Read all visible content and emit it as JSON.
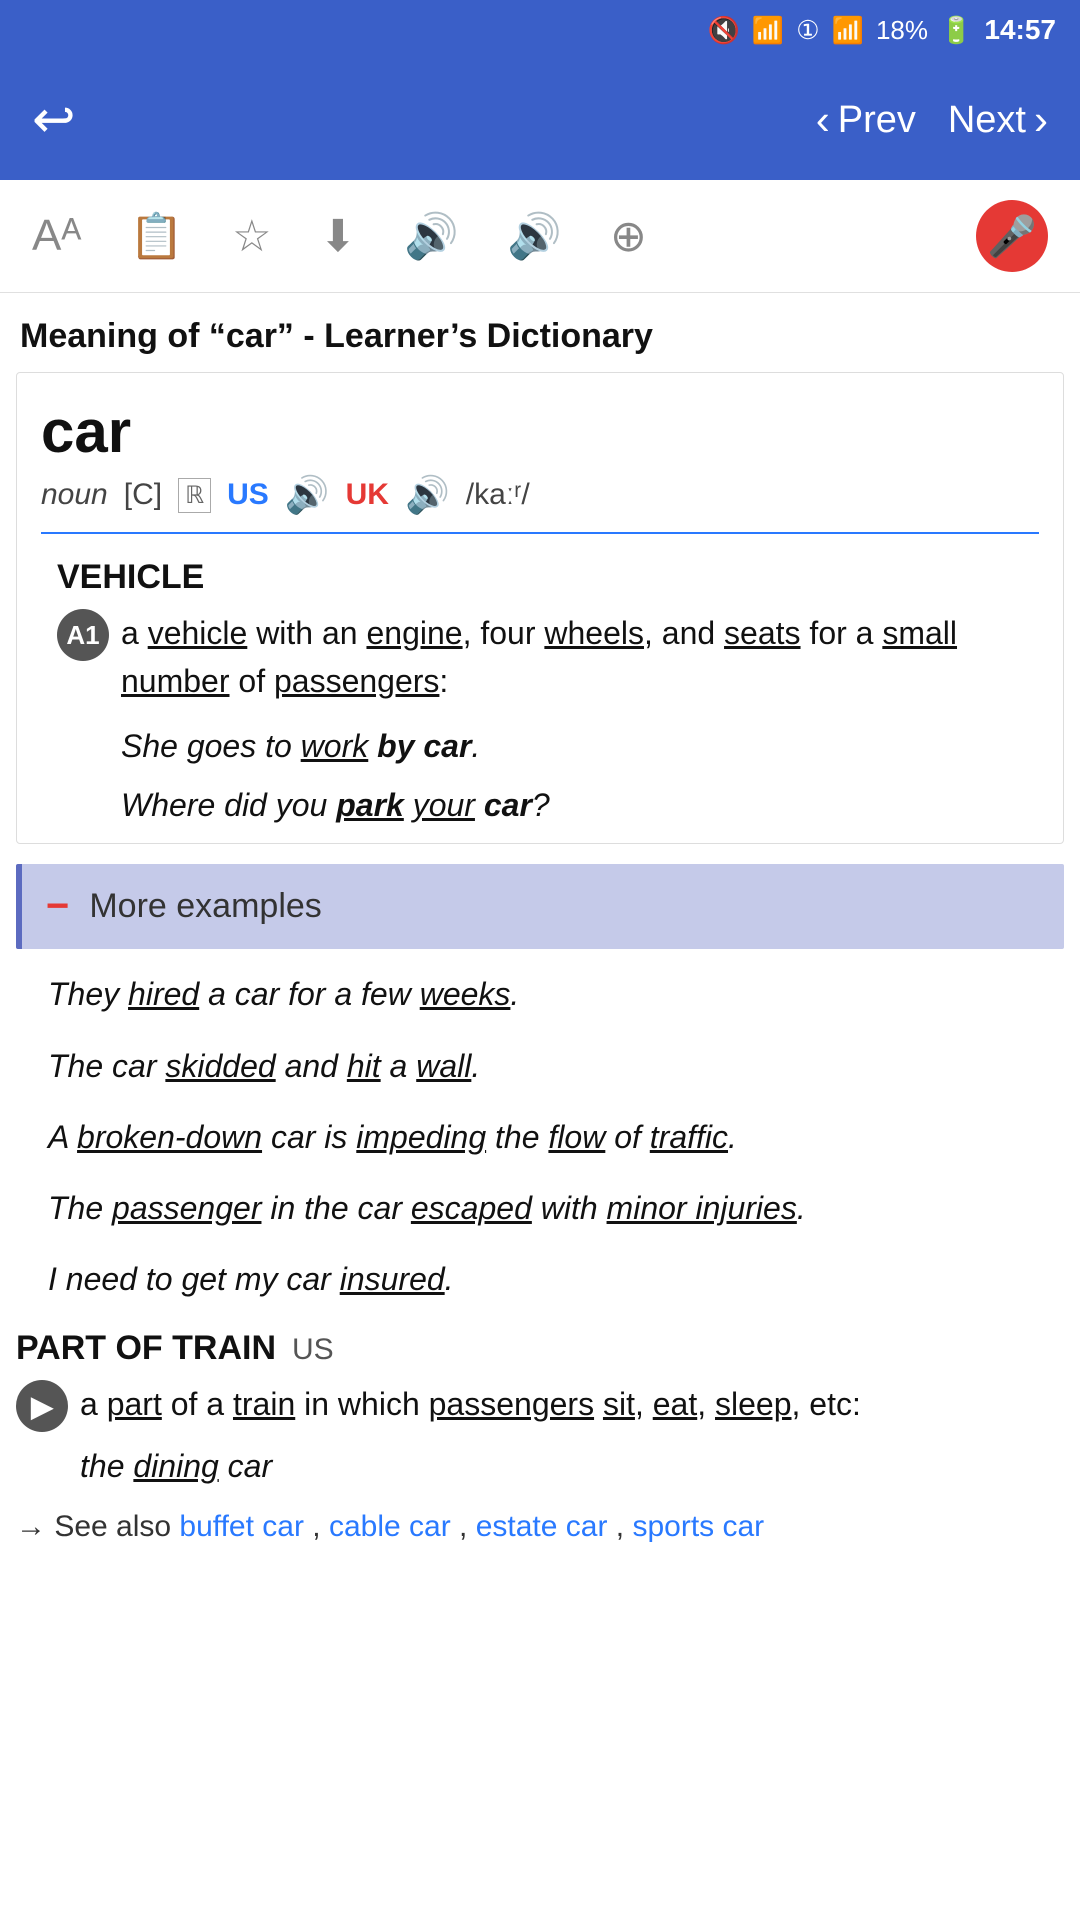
{
  "status_bar": {
    "time": "14:57",
    "battery": "18%",
    "signal": "4G"
  },
  "nav": {
    "prev_label": "Prev",
    "next_label": "Next"
  },
  "toolbar": {
    "icons": [
      "Aa",
      "copy",
      "star",
      "download",
      "sound-blue",
      "sound-red",
      "plus"
    ]
  },
  "page_title": "Meaning of “car” - Learner’s Dictionary",
  "entry": {
    "word": "car",
    "pos": "noun",
    "countable": "[C]",
    "us_label": "US",
    "uk_label": "UK",
    "phonetic": "/kaːʳ/",
    "sections": [
      {
        "heading": "VEHICLE",
        "level_badge": "A1",
        "definition": "a vehicle with an engine, four wheels, and seats for a small number of passengers:",
        "examples": [
          "She goes to work by car.",
          "Where did you park your car?"
        ],
        "more_examples_label": "More examples",
        "more_examples": [
          "They hired a car for a few weeks.",
          "The car skidded and hit a wall.",
          "A broken-down car is impeding the flow of traffic.",
          "The passenger in the car escaped with minor injuries.",
          "I need to get my car insured."
        ]
      },
      {
        "heading": "PART OF TRAIN",
        "sub_heading": "US",
        "definition": "a part of a train in which passengers sit, eat, sleep, etc:",
        "examples": [
          "the dining car"
        ]
      }
    ],
    "see_also": {
      "label": "→ See also",
      "links": [
        "buffet car",
        "cable car",
        "estate car",
        "sports car"
      ]
    }
  }
}
